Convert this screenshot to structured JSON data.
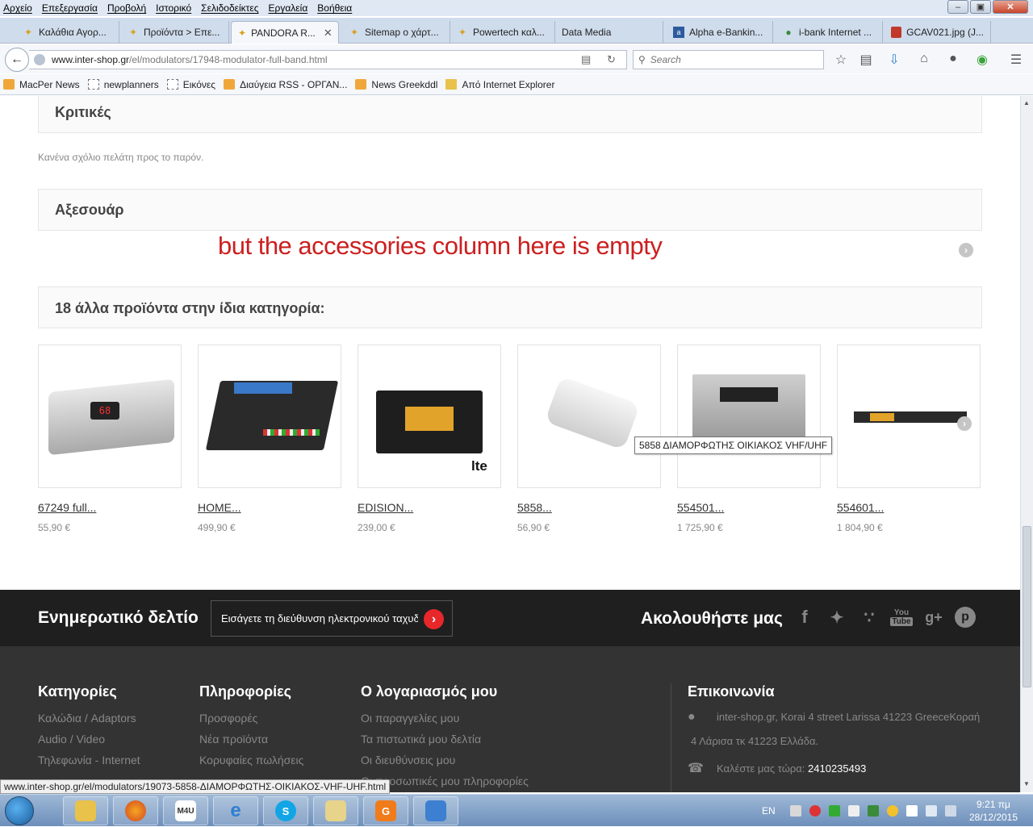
{
  "menu": [
    "Αρχείο",
    "Επεξεργασία",
    "Προβολή",
    "Ιστορικό",
    "Σελιδοδείκτες",
    "Εργαλεία",
    "Βοήθεια"
  ],
  "tabs": [
    {
      "label": "Καλάθια Αγορ..."
    },
    {
      "label": "Προϊόντα > Επε..."
    },
    {
      "label": "PANDORA R...",
      "active": true
    },
    {
      "label": "Sitemap ο χάρτ..."
    },
    {
      "label": "Powertech καλ..."
    },
    {
      "label": "Data Media"
    },
    {
      "label": "Alpha e-Bankin..."
    },
    {
      "label": "i-bank Internet ..."
    },
    {
      "label": "GCAV021.jpg (J..."
    }
  ],
  "address": {
    "host": "www.inter-shop.gr",
    "path": "/el/modulators/17948-modulator-full-band.html"
  },
  "search": {
    "placeholder": "Search"
  },
  "bookmarks": [
    {
      "label": "MacPer News",
      "icon": "rss-icon"
    },
    {
      "label": "newplanners",
      "icon": "page-icon"
    },
    {
      "label": "Εικόνες",
      "icon": "page-icon"
    },
    {
      "label": "Διαύγεια RSS - ΟΡΓΑΝ...",
      "icon": "rss-icon"
    },
    {
      "label": "News Greekddl",
      "icon": "rss-icon"
    },
    {
      "label": "Από Internet Explorer",
      "icon": "folder-icon"
    }
  ],
  "reviews": {
    "title": "Κριτικές",
    "empty_text": "Κανένα σχόλιο πελάτη προς το παρόν."
  },
  "accessories": {
    "title": "Αξεσουάρ",
    "annotation": "but the accessories column here is empty"
  },
  "related": {
    "title": "18 άλλα προϊόντα στην ίδια κατηγορία:",
    "products": [
      {
        "name": "67249 full...",
        "price": "55,90 €"
      },
      {
        "name": "HOME...",
        "price": "499,90 €"
      },
      {
        "name": "EDISION...",
        "price": "239,00 €",
        "badge": "lte"
      },
      {
        "name": "5858...",
        "price": "56,90 €"
      },
      {
        "name": "554501...",
        "price": "1 725,90 €"
      },
      {
        "name": "554601...",
        "price": "1 804,90 €"
      }
    ],
    "tooltip": "5858 ΔΙΑΜΟΡΦΩΤΗΣ ΟΙΚΙΑΚΟΣ VHF/UHF"
  },
  "newsletter": {
    "title": "Ενημερωτικό δελτίο",
    "placeholder": "Εισάγετε τη διεύθυνση ηλεκτρονικού ταχυδ",
    "follow": "Ακολουθήστε μας",
    "youtube_top": "You",
    "youtube_bottom": "Tube"
  },
  "footer": {
    "categories": {
      "title": "Κατηγορίες",
      "links": [
        "Καλώδια / Adaptors",
        "Audio / Video",
        "Τηλεφωνία - Internet"
      ]
    },
    "info": {
      "title": "Πληροφορίες",
      "links": [
        "Προσφορές",
        "Νέα προϊόντα",
        "Κορυφαίες πωλήσεις"
      ]
    },
    "account": {
      "title": "Ο λογαριασμός μου",
      "links": [
        "Οι παραγγελίες μου",
        "Τα πιστωτικά μου δελτία",
        "Οι διευθύνσεις μου",
        "Οι προσωπικές μου πληροφορίες"
      ]
    },
    "contact": {
      "title": "Επικοινωνία",
      "address_1": "inter-shop.gr, Korai 4 street Larissa 41223 GreeceΚοραή",
      "address_2": "4 Λάρισα τκ 41223 Ελλάδα.",
      "call_label": "Καλέστε μας τώρα:",
      "phone": "2410235493"
    }
  },
  "statusbar": {
    "url": "www.inter-shop.gr/el/modulators/19073-5858-ΔΙΑΜΟΡΦΩΤΗΣ-ΟΙΚΙΑΚΟΣ-VHF-UHF.html"
  },
  "taskbar": {
    "lang": "EN",
    "time": "9:21 πμ",
    "date": "28/12/2015"
  },
  "colors": {
    "accent_red": "#e8272b",
    "annotation_red": "#cc1f1f",
    "footer_bg": "#333333",
    "newsletter_bg": "#1f1f1f"
  }
}
